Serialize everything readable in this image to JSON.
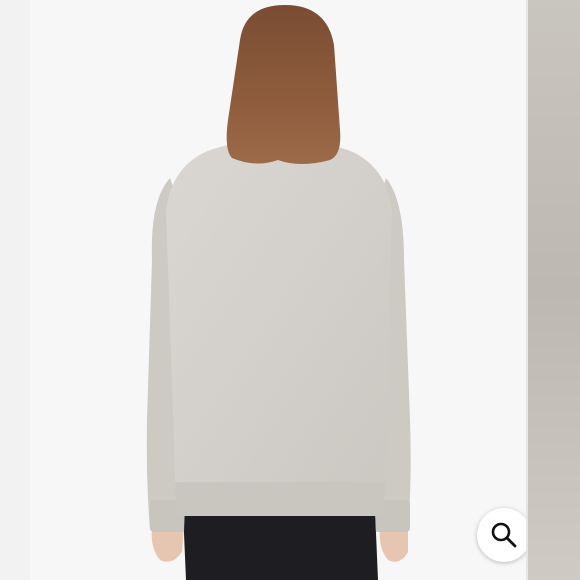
{
  "image_viewer": {
    "main_image": "woman-gray-sweatshirt-back-view",
    "zoom_button_icon": "search-icon",
    "colors": {
      "background": "#f7f7f7",
      "sweater": "#d4d0cb",
      "hair": "#8a5a3b",
      "pants": "#1e1e22"
    }
  }
}
